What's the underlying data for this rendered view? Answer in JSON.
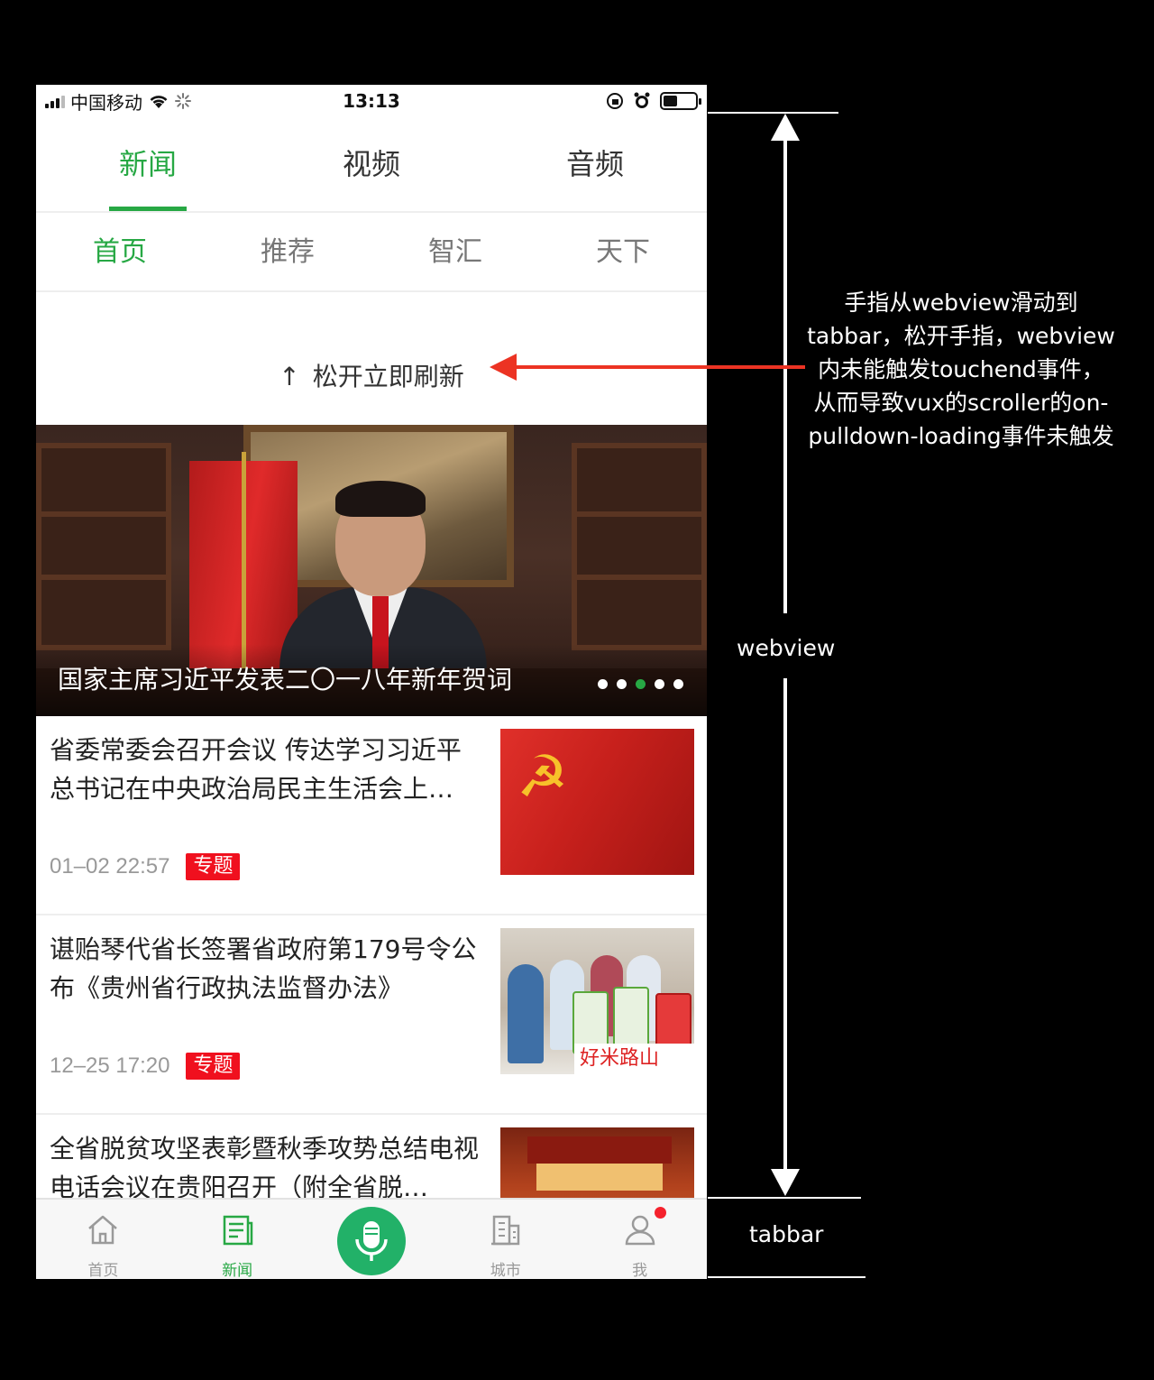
{
  "status_bar": {
    "carrier": "中国移动",
    "time": "13:13",
    "battery_level": 0.45
  },
  "main_tabs": [
    {
      "label": "新闻",
      "active": true
    },
    {
      "label": "视频",
      "active": false
    },
    {
      "label": "音频",
      "active": false
    }
  ],
  "sub_tabs": [
    {
      "label": "首页",
      "active": true
    },
    {
      "label": "推荐",
      "active": false
    },
    {
      "label": "智汇",
      "active": false
    },
    {
      "label": "天下",
      "active": false
    }
  ],
  "pulldown": {
    "arrow": "↑",
    "text": "松开立即刷新"
  },
  "banner": {
    "caption": "国家主席习近平发表二〇一八年新年贺词",
    "slide_count": 5,
    "active_slide": 3
  },
  "news": [
    {
      "title": "省委常委会召开会议 传达学习习近平总书记在中央政治局民主生活会上…",
      "time": "01–02 22:57",
      "tag": "专题",
      "thumb": "party-flag"
    },
    {
      "title": "谌贻琴代省长签署省政府第179号令公布《贵州省行政执法监督办法》",
      "time": "12–25 17:20",
      "tag": "专题",
      "thumb": "market-inspection",
      "thumb_sign": "好米路山"
    },
    {
      "title": "全省脱贫攻坚表彰暨秋季攻势总结电视电话会议在贵阳召开（附全省脱…",
      "thumb": "conference-hall"
    }
  ],
  "tabbar": {
    "items": [
      {
        "label": "首页",
        "icon": "home-icon",
        "active": false
      },
      {
        "label": "新闻",
        "icon": "news-icon",
        "active": true
      },
      {
        "label": "",
        "icon": "microphone-icon",
        "active": false
      },
      {
        "label": "城市",
        "icon": "city-icon",
        "active": false
      },
      {
        "label": "我",
        "icon": "user-icon",
        "active": false,
        "badge": true
      }
    ]
  },
  "annotations": {
    "description": [
      "手指从webview滑动到",
      "tabbar，松开手指，webview",
      "内未能触发touchend事件，",
      "从而导致vux的scroller的on-",
      "pulldown-loading事件未触发"
    ],
    "webview_label": "webview",
    "tabbar_label": "tabbar"
  },
  "colors": {
    "accent": "#27a844",
    "tag": "#f0101e",
    "annotation_arrow": "#ec3323",
    "mic_button": "#22b168"
  }
}
